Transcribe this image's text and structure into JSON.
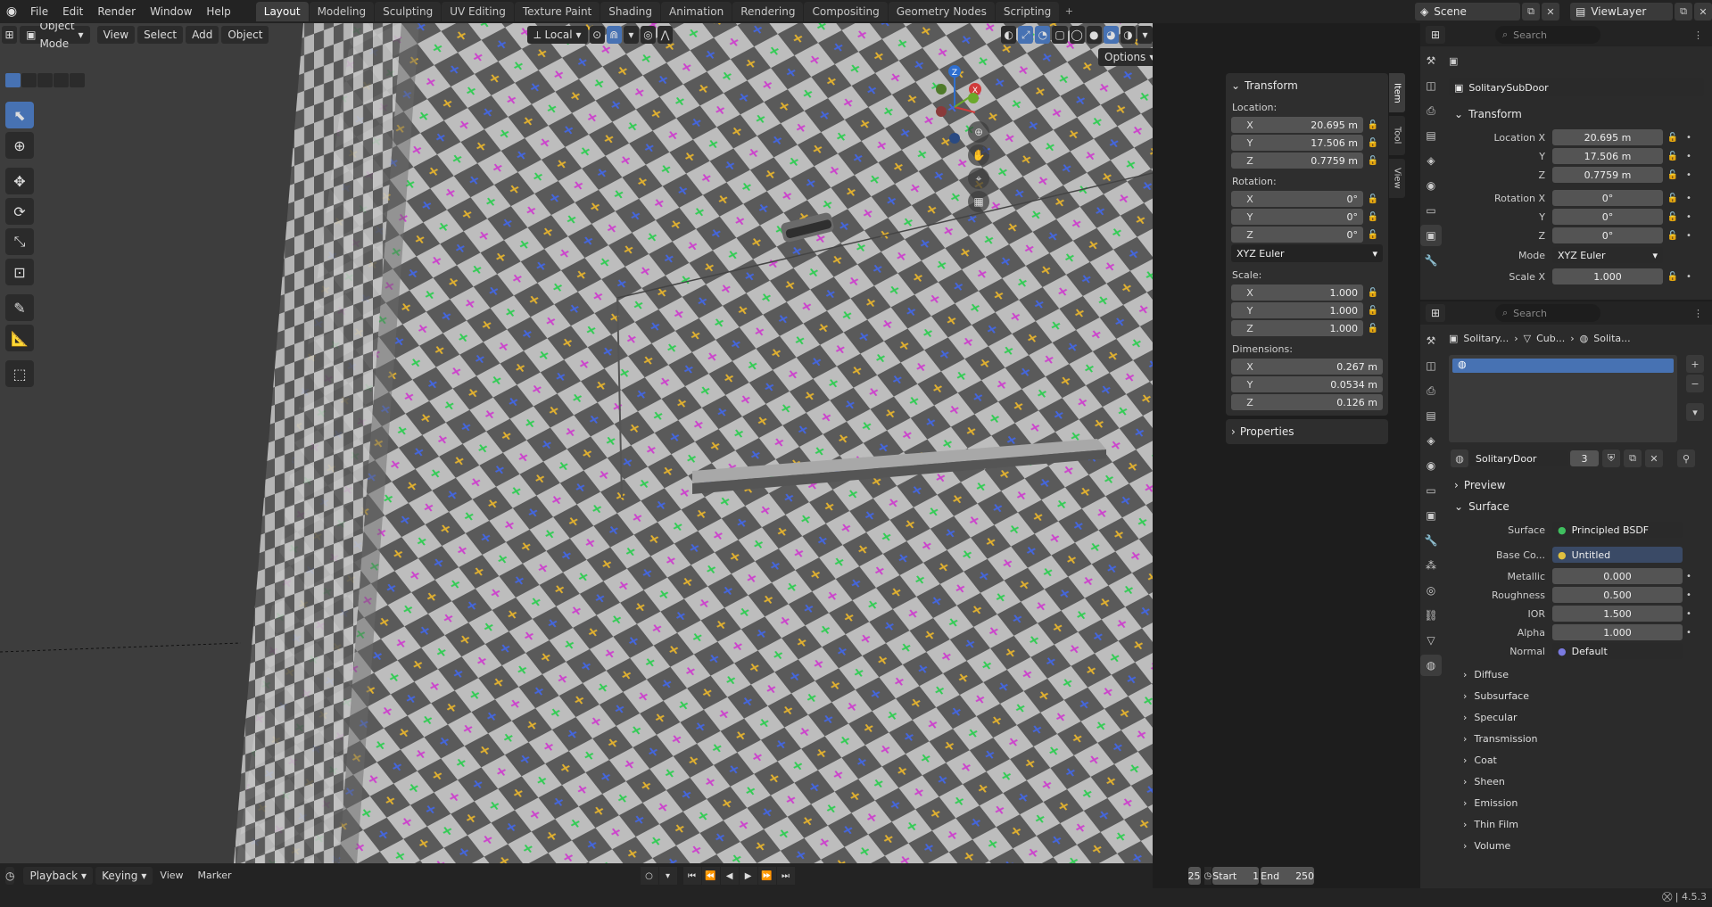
{
  "menus": [
    "File",
    "Edit",
    "Render",
    "Window",
    "Help"
  ],
  "workspaces": [
    "Layout",
    "Modeling",
    "Sculpting",
    "UV Editing",
    "Texture Paint",
    "Shading",
    "Animation",
    "Rendering",
    "Compositing",
    "Geometry Nodes",
    "Scripting"
  ],
  "active_workspace": "Layout",
  "scene_name": "Scene",
  "view_layer": "ViewLayer",
  "viewport_header": {
    "mode": "Object Mode",
    "menus": [
      "View",
      "Select",
      "Add",
      "Object"
    ],
    "orientation": "Local",
    "options_label": "Options"
  },
  "npanel": {
    "transform_title": "Transform",
    "location_label": "Location:",
    "location": {
      "x": "20.695 m",
      "y": "17.506 m",
      "z": "0.7759 m"
    },
    "rotation_label": "Rotation:",
    "rotation": {
      "x": "0°",
      "y": "0°",
      "z": "0°"
    },
    "rotation_mode": "XYZ Euler",
    "scale_label": "Scale:",
    "scale": {
      "x": "1.000",
      "y": "1.000",
      "z": "1.000"
    },
    "dimensions_label": "Dimensions:",
    "dimensions": {
      "x": "0.267 m",
      "y": "0.0534 m",
      "z": "0.126 m"
    },
    "properties_title": "Properties",
    "tabs": [
      "Item",
      "Tool",
      "View"
    ],
    "axis": {
      "x": "X",
      "y": "Y",
      "z": "Z"
    }
  },
  "timeline": {
    "menus": [
      "Playback",
      "Keying",
      "View",
      "Marker"
    ],
    "current_frame": "25",
    "start_label": "Start",
    "start": "1",
    "end_label": "End",
    "end": "250"
  },
  "object_props": {
    "search_placeholder": "Search",
    "object_name": "SolitarySubDoor",
    "section": "Transform",
    "location_x_label": "Location X",
    "y_label": "Y",
    "z_label": "Z",
    "rotation_x_label": "Rotation X",
    "mode_label": "Mode",
    "scale_x_label": "Scale X",
    "location": {
      "x": "20.695 m",
      "y": "17.506 m",
      "z": "0.7759 m"
    },
    "rotation": {
      "x": "0°",
      "y": "0°",
      "z": "0°"
    },
    "mode": "XYZ Euler",
    "scale_x": "1.000"
  },
  "material_props": {
    "search_placeholder": "Search",
    "breadcrumb": [
      "Solitary...",
      "Cub...",
      "Solita..."
    ],
    "material_name": "SolitaryDoor",
    "user_count": "3",
    "preview_label": "Preview",
    "surface_section": "Surface",
    "surface_label": "Surface",
    "surface_value": "Principled BSDF",
    "base_color_label": "Base Co...",
    "base_color_value": "Untitled",
    "metallic_label": "Metallic",
    "metallic": "0.000",
    "roughness_label": "Roughness",
    "roughness": "0.500",
    "ior_label": "IOR",
    "ior": "1.500",
    "alpha_label": "Alpha",
    "alpha": "1.000",
    "normal_label": "Normal",
    "normal_value": "Default",
    "subsections": [
      "Diffuse",
      "Subsurface",
      "Specular",
      "Transmission",
      "Coat",
      "Sheen",
      "Emission",
      "Thin Film",
      "Volume"
    ]
  },
  "version": "4.5.3",
  "colors": {
    "accent": "#4772b3",
    "checker_light": "#b9b9b9",
    "checker_dark": "#5a5a5a"
  }
}
